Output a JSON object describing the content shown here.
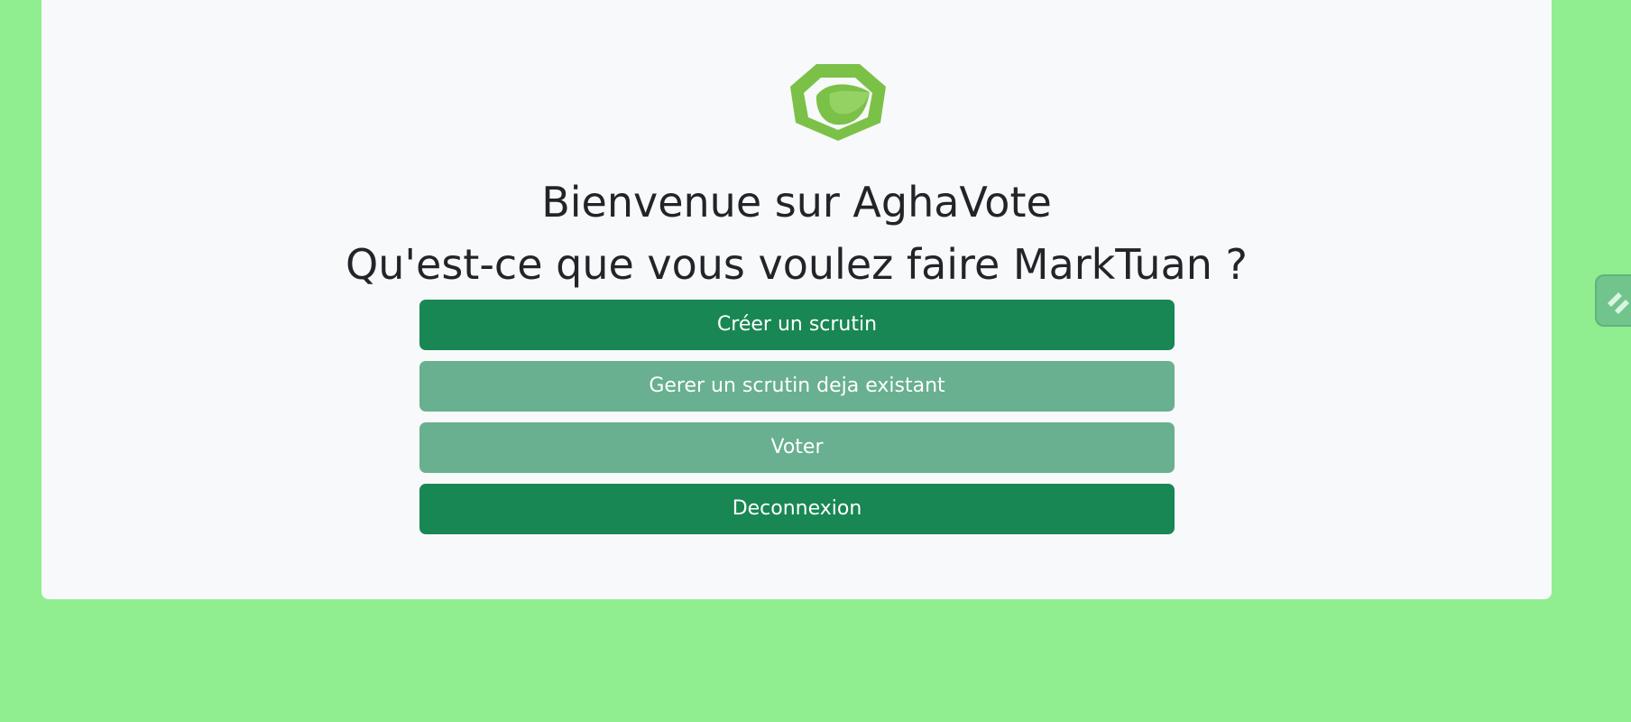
{
  "app": {
    "title_line1": "Bienvenue sur AghaVote",
    "title_line2": "Qu'est-ce que vous voulez faire MarkTuan ?"
  },
  "logo": {
    "icon": "leaf-hexagon-logo",
    "color": "#7BC148"
  },
  "actions": {
    "create_label": "Créer un scrutin",
    "manage_label": "Gerer un scrutin deja existant",
    "vote_label": "Voter",
    "logout_label": "Deconnexion"
  },
  "side_handle": {
    "icon": "extension-handle-icon"
  },
  "colors": {
    "page_background": "#90EE90",
    "card_background": "#F8F9FA",
    "primary_button": "#198754",
    "muted_button": "#68B08F",
    "text": "#212529"
  }
}
